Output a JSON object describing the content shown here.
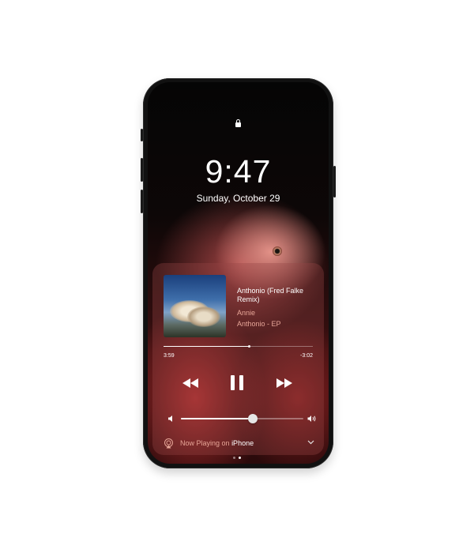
{
  "lockscreen": {
    "time": "9:47",
    "date": "Sunday, October 29"
  },
  "now_playing": {
    "song_title": "Anthonio (Fred Falke Remix)",
    "artist": "Annie",
    "album": "Anthonio - EP",
    "elapsed": "3:59",
    "remaining": "-3:02",
    "progress": 0.57,
    "volume": 0.59,
    "output_prefix": "Now Playing on",
    "output_device": "iPhone"
  },
  "icons": {
    "lock": "lock-icon",
    "rewind": "rewind-icon",
    "pause": "pause-icon",
    "fast_forward": "fast-forward-icon",
    "volume_low": "volume-low-icon",
    "volume_high": "volume-high-icon",
    "airplay": "airplay-icon",
    "chevron": "chevron-down-icon"
  },
  "page_indicator": {
    "count": 2,
    "active": 1
  },
  "colors": {
    "accent_text": "#e6a597",
    "phone_body": "#111111",
    "player_tint": "rgba(150,70,70,0.35)"
  }
}
